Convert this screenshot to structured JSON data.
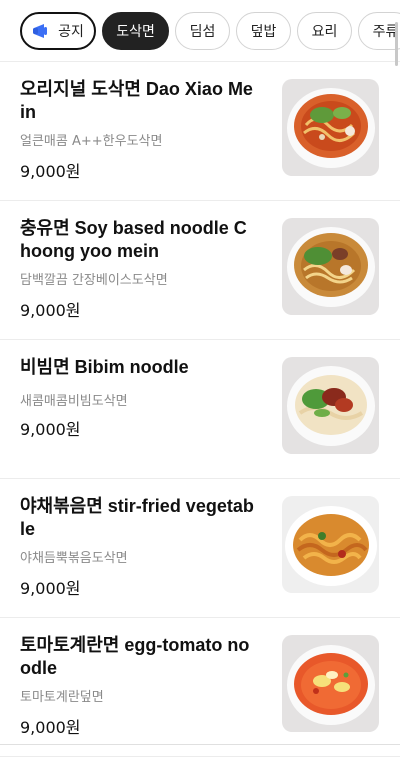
{
  "tabs": [
    {
      "label": "공지",
      "icon": "megaphone-icon"
    },
    {
      "label": "도삭면",
      "active": true
    },
    {
      "label": "딤섬"
    },
    {
      "label": "덮밥"
    },
    {
      "label": "요리"
    },
    {
      "label": "주류"
    }
  ],
  "menu": [
    {
      "name": "오리지널 도삭면 Dao Xiao Mein",
      "desc": "얼큰매콤 A++한우도삭면",
      "price": "9,000원"
    },
    {
      "name": "충유면 Soy based noodle Choong yoo mein",
      "desc": "담백깔끔 간장베이스도삭면",
      "price": "9,000원"
    },
    {
      "name": "비빔면 Bibim noodle",
      "desc": "새콤매콤비빔도삭면",
      "price": "9,000원"
    },
    {
      "name": "야채볶음면 stir-fried vegetable",
      "desc": "야채듬뿍볶음도삭면",
      "price": "9,000원"
    },
    {
      "name": "토마토계란면 egg-tomato noodle",
      "desc": "토마토계란덮면",
      "price": "9,000원"
    }
  ],
  "colors": {
    "accent": "#3b6ff5",
    "active_tab": "#222222",
    "desc_gray": "#8a8a8a"
  }
}
